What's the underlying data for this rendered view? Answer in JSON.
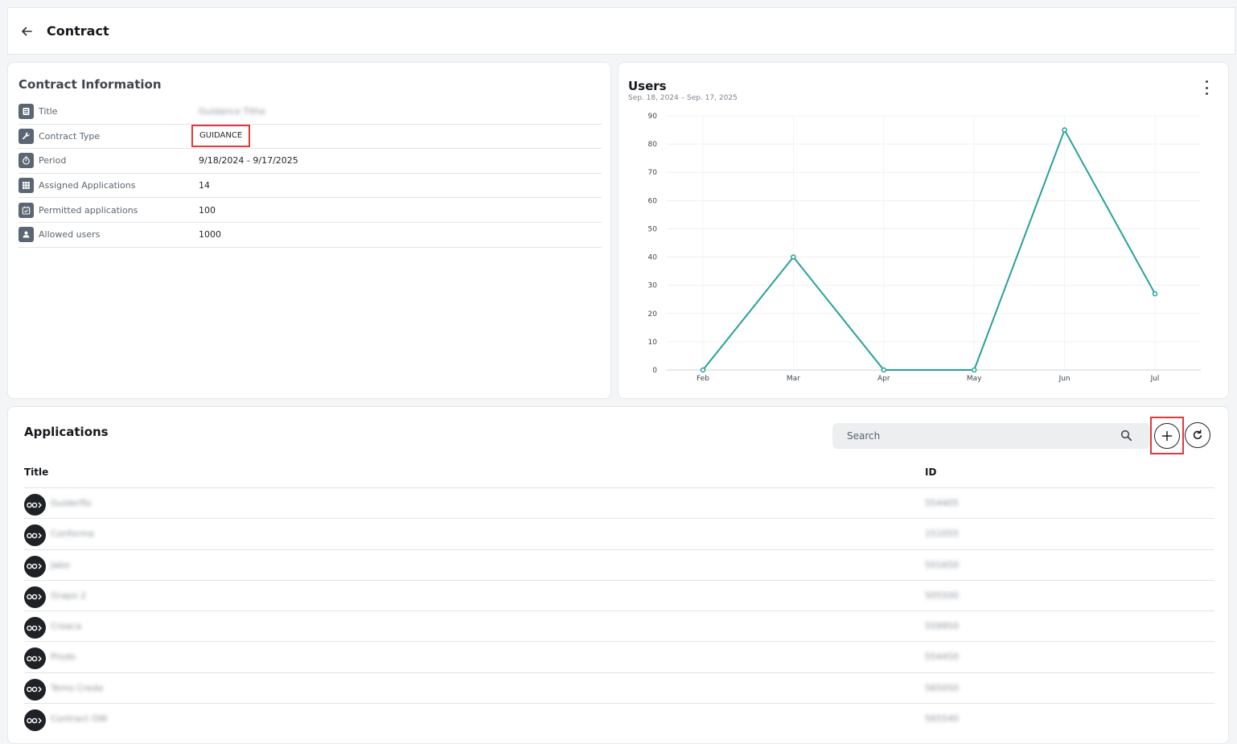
{
  "header": {
    "title": "Contract"
  },
  "info": {
    "title": "Contract Information",
    "rows": [
      {
        "label": "Title",
        "value": "Guidance Tithe",
        "icon": "list-icon"
      },
      {
        "label": "Contract Type",
        "value": "GUIDANCE",
        "icon": "wrench-icon"
      },
      {
        "label": "Period",
        "value": "9/18/2024 - 9/17/2025",
        "icon": "stopwatch-icon"
      },
      {
        "label": "Assigned Applications",
        "value": "14",
        "icon": "grid-icon"
      },
      {
        "label": "Permitted applications",
        "value": "100",
        "icon": "calendar-check-icon"
      },
      {
        "label": "Allowed users",
        "value": "1000",
        "icon": "users-icon"
      }
    ]
  },
  "users": {
    "title": "Users",
    "subtitle": "Sep. 18, 2024 – Sep. 17, 2025"
  },
  "chart_data": {
    "type": "line",
    "categories": [
      "Feb",
      "Mar",
      "Apr",
      "May",
      "Jun",
      "Jul"
    ],
    "values": [
      0,
      40,
      0,
      0,
      85,
      27
    ],
    "ylim": [
      0,
      90
    ],
    "yticks": [
      0,
      10,
      20,
      30,
      40,
      50,
      60,
      70,
      80,
      90
    ],
    "grid": true,
    "color": "#26a199"
  },
  "apps": {
    "title": "Applications",
    "search_placeholder": "Search",
    "col_title": "Title",
    "col_id": "ID",
    "rows": [
      {
        "name": "Guiderflo",
        "id": "554405"
      },
      {
        "name": "Conforma",
        "id": "151055"
      },
      {
        "name": "Jabo",
        "id": "501650"
      },
      {
        "name": "Grapo 2",
        "id": "505500"
      },
      {
        "name": "Creaca",
        "id": "559950"
      },
      {
        "name": "Prodo",
        "id": "554450"
      },
      {
        "name": "Temo Creda",
        "id": "565050"
      },
      {
        "name": "Contract OW",
        "id": "565540"
      }
    ]
  }
}
